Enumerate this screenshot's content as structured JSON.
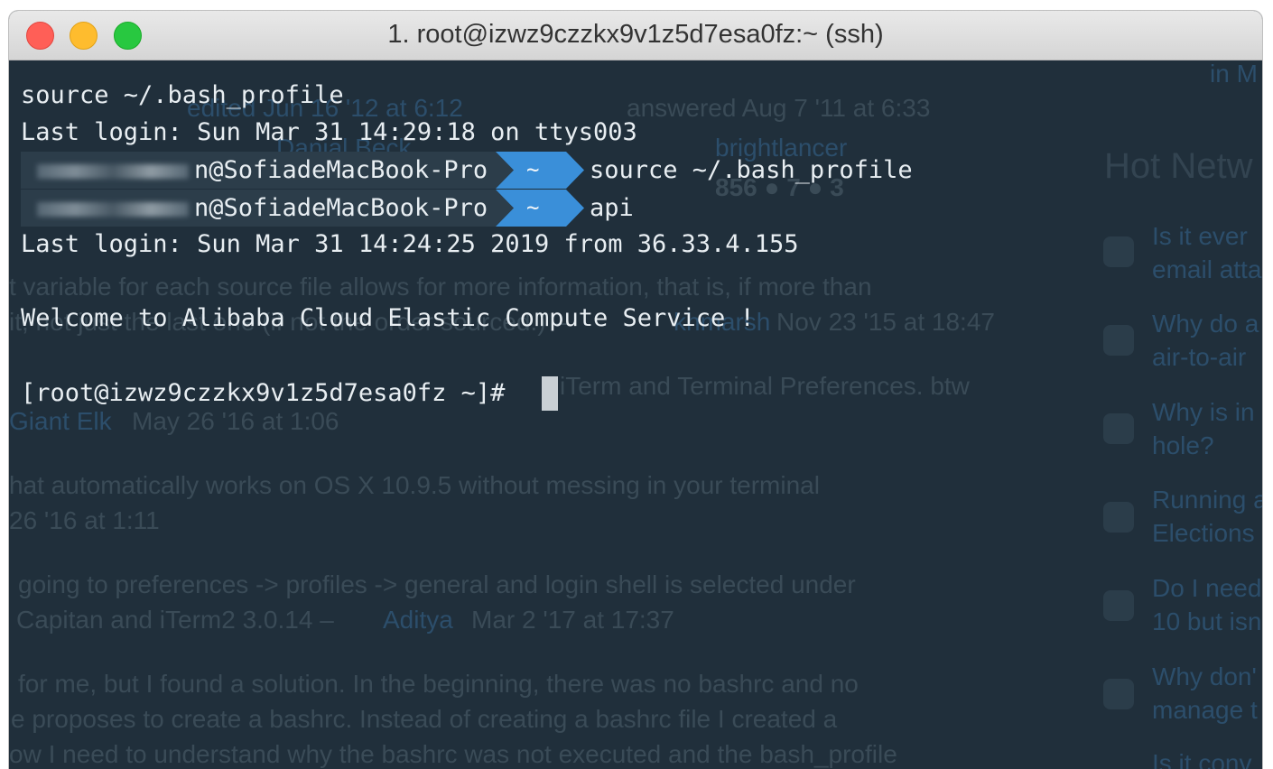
{
  "window": {
    "title": "1. root@izwz9czzkx9v1z5d7esa0fz:~ (ssh)"
  },
  "terminal": {
    "lines": {
      "l1": "source ~/.bash_profile",
      "l2": "Last login: Sun Mar 31 14:29:18 on ttys003",
      "l5": "Last login: Sun Mar 31 14:24:25 2019 from 36.33.4.155",
      "welcome": "Welcome to Alibaba Cloud Elastic Compute Service !",
      "prompt": "[root@izwz9czzkx9v1z5d7esa0fz ~]# "
    },
    "prompt1": {
      "host_suffix": "n@SofiadeMacBook-Pro",
      "dir": "~",
      "command": "source ~/.bash_profile"
    },
    "prompt2": {
      "host_suffix": "n@SofiadeMacBook-Pro",
      "dir": "~",
      "command": "api"
    }
  },
  "background_page": {
    "t1": "edited Jun 16 '12 at 6:12",
    "t2": "answered Aug 7 '11 at 6:33",
    "t3": "Danial Beck",
    "t4": "brightlancer",
    "t5": "856 ● 7 ● 3",
    "t6": "in M",
    "t7": "Hot Netw",
    "t8": "t variable for each source file allows for more information, that is, if more than",
    "t9": "it, not just the last one (if not the order sourced.) –",
    "t10": "khmarsh",
    "t11": "Nov 23 '15 at 18:47",
    "t12": "iTerm and Terminal Preferences. btw",
    "t13": "Giant Elk",
    "t14": "May 26 '16 at 1:06",
    "t15": "hat automatically works on OS X 10.9.5 without messing in your terminal",
    "t16": "26 '16 at 1:11",
    "t17": "going to preferences -> profiles -> general and login shell is selected under",
    "t18": "Capitan and iTerm2 3.0.14 –",
    "t19": "Aditya",
    "t20": "Mar 2 '17 at 17:37",
    "t21": "for me, but I found a solution. In the beginning, there was no bashrc and no",
    "t22": "e proposes to create a bashrc. Instead of creating a bashrc file I created a",
    "t23": "ow I need to understand why the bashrc was not executed and the bash_profile",
    "s1a": "Is it ever",
    "s1b": "email atta",
    "s2a": "Why do a",
    "s2b": "air-to-air",
    "s3a": "Why is in",
    "s3b": "hole?",
    "s4a": "Running a",
    "s4b": "Elections",
    "s5a": "Do I need",
    "s5b": "10 but isn",
    "s6a": "Why don'",
    "s6b": "manage t",
    "s7a": "Is it conv"
  },
  "colors": {
    "terminal_bg": "#202f3b",
    "segment_host_bg": "#2c3d4a",
    "segment_dir_bg": "#3a8fd9",
    "text": "#e8eef2"
  }
}
